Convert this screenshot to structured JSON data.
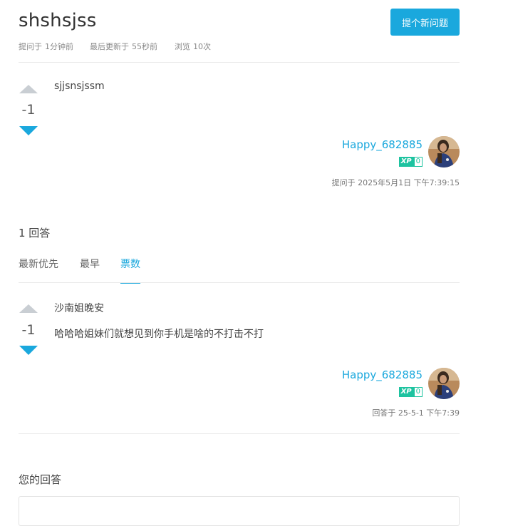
{
  "question": {
    "title": "shshsjss",
    "meta": {
      "asked_label": "提问于",
      "asked_value": "1分钟前",
      "updated_label": "最后更新于",
      "updated_value": "55秒前",
      "views_label": "浏览",
      "views_value": "10次"
    },
    "votes": "-1",
    "body": "sjjsnsjssm",
    "author": {
      "name": "Happy_682885",
      "xp_tag": "XP",
      "xp": "0"
    },
    "timestamp": "提问于 2025年5月1日 下午7:39:15"
  },
  "new_question_button": "提个新问题",
  "answers_count": "1 回答",
  "tabs": [
    {
      "label": "最新优先",
      "active": false
    },
    {
      "label": "最早",
      "active": false
    },
    {
      "label": "票数",
      "active": true
    }
  ],
  "answer": {
    "votes": "-1",
    "lines": [
      "沙南姐晚安",
      "哈哈哈姐妹们就想见到你手机是啥的不打击不打"
    ],
    "author": {
      "name": "Happy_682885",
      "xp_tag": "XP",
      "xp": "0"
    },
    "timestamp": "回答于 25-5-1 下午7:39"
  },
  "your_answer_label": "您的回答",
  "colors": {
    "accent": "#1aa8dd",
    "xp": "#1ec3a0",
    "upvote_inactive": "#c9ced3"
  }
}
